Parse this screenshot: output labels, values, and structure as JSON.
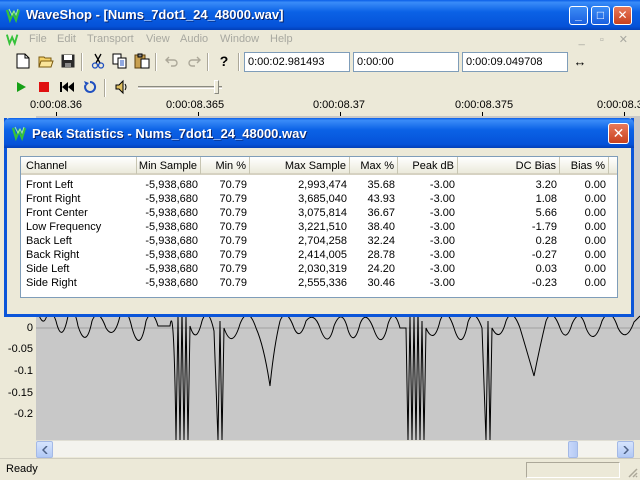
{
  "window": {
    "title": "WaveShop - [Nums_7dot1_24_48000.wav]",
    "minimize_glyph": "_",
    "maximize_glyph": "□",
    "close_glyph": "✕"
  },
  "menu": {
    "items": [
      "File",
      "Edit",
      "Transport",
      "View",
      "Audio",
      "Window",
      "Help"
    ],
    "mdi_glyphs": "_ ▫ ✕"
  },
  "toolbar": {
    "help_glyph": "?",
    "cursor_time": "0:00:02.981493",
    "selection_time": "0:00:00",
    "length_time": "0:00:09.049708",
    "fit_glyph": "↔"
  },
  "ruler": {
    "labels": [
      "0:00:08.36",
      "0:00:08.365",
      "0:00:08.37",
      "0:00:08.375",
      "0:00:08.3"
    ]
  },
  "yaxis": {
    "labels": [
      "0",
      "-0.05",
      "-0.1",
      "-0.15",
      "-0.2"
    ]
  },
  "status": {
    "text": "Ready"
  },
  "dialog": {
    "title": "Peak Statistics - Nums_7dot1_24_48000.wav",
    "close_glyph": "✕",
    "columns": [
      "Channel",
      "Min Sample",
      "Min %",
      "Max Sample",
      "Max %",
      "Peak dB",
      "DC Bias",
      "Bias %"
    ],
    "rows": [
      [
        "Front Left",
        "-5,938,680",
        "70.79",
        "2,993,474",
        "35.68",
        "-3.00",
        "3.20",
        "0.00"
      ],
      [
        "Front Right",
        "-5,938,680",
        "70.79",
        "3,685,040",
        "43.93",
        "-3.00",
        "1.08",
        "0.00"
      ],
      [
        "Front Center",
        "-5,938,680",
        "70.79",
        "3,075,814",
        "36.67",
        "-3.00",
        "5.66",
        "0.00"
      ],
      [
        "Low Frequency",
        "-5,938,680",
        "70.79",
        "3,221,510",
        "38.40",
        "-3.00",
        "-1.79",
        "0.00"
      ],
      [
        "Back Left",
        "-5,938,680",
        "70.79",
        "2,704,258",
        "32.24",
        "-3.00",
        "0.28",
        "0.00"
      ],
      [
        "Back Right",
        "-5,938,680",
        "70.79",
        "2,414,005",
        "28.78",
        "-3.00",
        "-0.27",
        "0.00"
      ],
      [
        "Side Left",
        "-5,938,680",
        "70.79",
        "2,030,319",
        "24.20",
        "-3.00",
        "0.03",
        "0.00"
      ],
      [
        "Side Right",
        "-5,938,680",
        "70.79",
        "2,555,336",
        "30.46",
        "-3.00",
        "-0.23",
        "0.00"
      ]
    ]
  },
  "colors": {
    "titlebar": "#0552d8",
    "wave_bg": "#c8c8c8",
    "play_green": "#16a016",
    "stop_red": "#e01010"
  }
}
